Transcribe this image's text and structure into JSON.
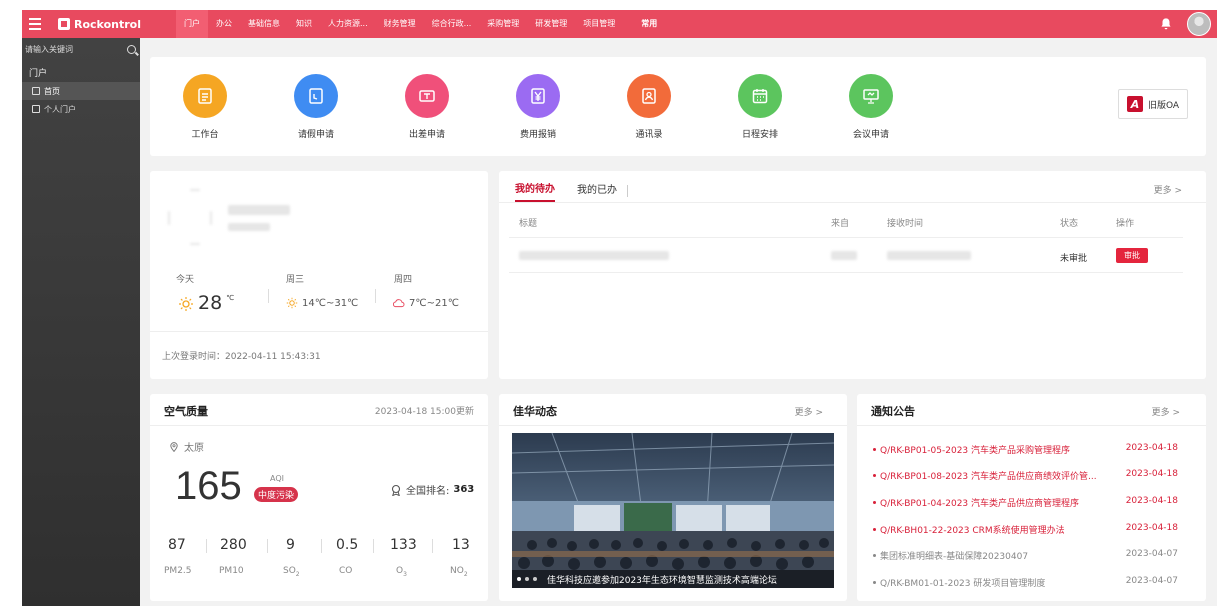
{
  "topbar": {
    "brand": "Rockontrol",
    "nav": [
      "门户",
      "办公",
      "基础信息",
      "知识",
      "人力资源...",
      "财务管理",
      "综合行政...",
      "采购管理",
      "研发管理",
      "项目管理"
    ],
    "nav_extra": "常用",
    "accent": "#e84a5f"
  },
  "sidebar": {
    "search_placeholder": "请输入关键词",
    "group": "门户",
    "items": [
      {
        "label": "首页",
        "active": true
      },
      {
        "label": "个人门户",
        "active": false
      }
    ]
  },
  "quick_links": [
    {
      "label": "工作台",
      "icon": "clipboard-icon",
      "color": "#f5a623"
    },
    {
      "label": "请假申请",
      "icon": "leave-note-icon",
      "color": "#3f8cf2"
    },
    {
      "label": "出差申请",
      "icon": "ticket-icon",
      "color": "#f0507a"
    },
    {
      "label": "费用报销",
      "icon": "yuan-icon",
      "color": "#9b6bf2"
    },
    {
      "label": "通讯录",
      "icon": "contacts-icon",
      "color": "#f26b3a"
    },
    {
      "label": "日程安排",
      "icon": "calendar-icon",
      "color": "#5cc55e"
    },
    {
      "label": "会议申请",
      "icon": "meeting-icon",
      "color": "#5cc55e"
    }
  ],
  "old_oa": {
    "badge": "A",
    "label": "旧版OA"
  },
  "weather": {
    "today_label": "今天",
    "today_temp": "28",
    "today_unit": "℃",
    "day2_label": "周三",
    "day2_range": "14℃~31℃",
    "day3_label": "周四",
    "day3_range": "7℃~21℃",
    "last_login": "上次登录时间：2022-04-11 15:43:31"
  },
  "todo": {
    "tabs": [
      "我的待办",
      "我的已办"
    ],
    "more": "更多 >",
    "headers": [
      "标题",
      "来自",
      "接收时间",
      "状态",
      "操作"
    ],
    "rows": [
      {
        "status": "未审批",
        "action": "审批"
      }
    ]
  },
  "air": {
    "title": "空气质量",
    "updated": "2023-04-18 15:00更新",
    "city": "太原",
    "aqi_label": "AQI",
    "aqi_value": "165",
    "level": "中度污染",
    "rank_label": "全国排名:",
    "rank_value": "363",
    "pollutants": [
      {
        "value": "87",
        "name": "PM2.5",
        "sub": ""
      },
      {
        "value": "280",
        "name": "PM10",
        "sub": ""
      },
      {
        "value": "9",
        "name": "SO",
        "sub": "2"
      },
      {
        "value": "0.5",
        "name": "CO",
        "sub": ""
      },
      {
        "value": "133",
        "name": "O",
        "sub": "3"
      },
      {
        "value": "13",
        "name": "NO",
        "sub": "2"
      }
    ]
  },
  "news": {
    "title": "佳华动态",
    "more": "更多 >",
    "caption": "佳华科技应邀参加2023年生态环境智慧监测技术高端论坛"
  },
  "notice": {
    "title": "通知公告",
    "more": "更多 >",
    "items": [
      {
        "text": "Q/RK-BP01-05-2023 汽车类产品采购管理程序",
        "date": "2023-04-18",
        "highlight": true
      },
      {
        "text": "Q/RK-BP01-08-2023 汽车类产品供应商绩效评价管...",
        "date": "2023-04-18",
        "highlight": true
      },
      {
        "text": "Q/RK-BP01-04-2023 汽车类产品供应商管理程序",
        "date": "2023-04-18",
        "highlight": true
      },
      {
        "text": "Q/RK-BH01-22-2023 CRM系统使用管理办法",
        "date": "2023-04-18",
        "highlight": true
      },
      {
        "text": "集团标准明细表-基础保障20230407",
        "date": "2023-04-07",
        "highlight": false
      },
      {
        "text": "Q/RK-BM01-01-2023 研发项目管理制度",
        "date": "2023-04-07",
        "highlight": false
      }
    ]
  }
}
